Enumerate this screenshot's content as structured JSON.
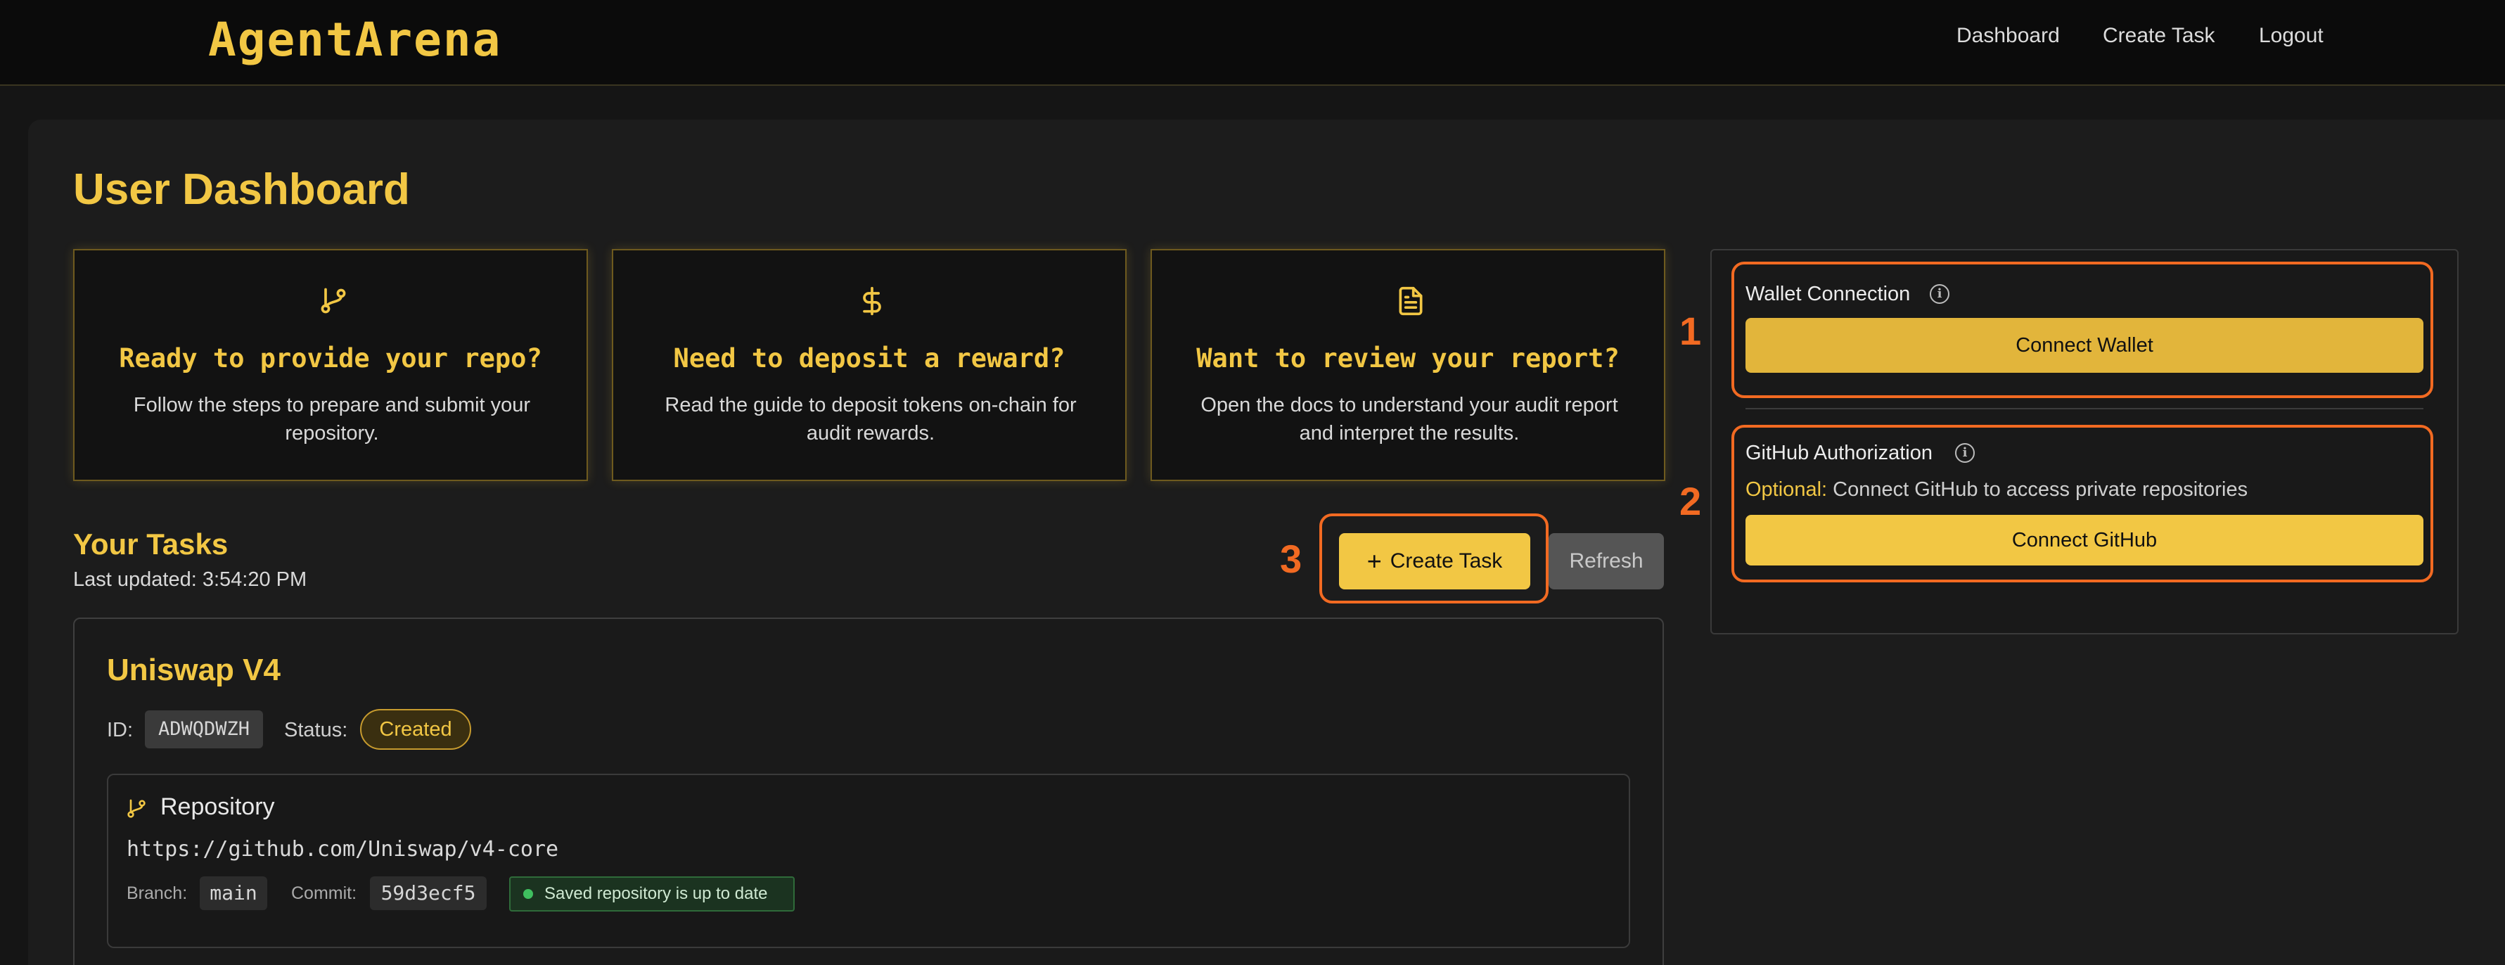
{
  "nav": {
    "logo": "AgentArena",
    "links": [
      "Dashboard",
      "Create Task",
      "Logout"
    ]
  },
  "page": {
    "title": "User Dashboard"
  },
  "cards": [
    {
      "icon": "git-branch-icon",
      "title": "Ready to provide your repo?",
      "desc": "Follow the steps to prepare and submit your repository."
    },
    {
      "icon": "dollar-icon",
      "title": "Need to deposit a reward?",
      "desc": "Read the guide to deposit tokens on-chain for audit rewards."
    },
    {
      "icon": "document-icon",
      "title": "Want to review your report?",
      "desc": "Open the docs to understand your audit report and interpret the results."
    }
  ],
  "tasks": {
    "title": "Your Tasks",
    "last_updated": "Last updated: 3:54:20 PM",
    "create_label": "Create Task",
    "refresh_label": "Refresh"
  },
  "task": {
    "name": "Uniswap V4",
    "id_label": "ID:",
    "id": "ADWQDWZH",
    "status_label": "Status:",
    "status": "Created",
    "repo": {
      "title": "Repository",
      "url": "https://github.com/Uniswap/v4-core",
      "branch_label": "Branch:",
      "branch": "main",
      "commit_label": "Commit:",
      "commit": "59d3ecf5",
      "saved": "Saved repository is up to date"
    }
  },
  "sidebar": {
    "wallet_label": "Wallet Connection",
    "wallet_button": "Connect Wallet",
    "github_label": "GitHub Authorization",
    "github_optional": "Optional:",
    "github_note": " Connect GitHub to access private repositories",
    "github_button": "Connect GitHub"
  },
  "annotations": [
    "1",
    "2",
    "3"
  ],
  "colors": {
    "accent": "#f2c744",
    "highlight": "#f26a22",
    "background": "#151515"
  }
}
